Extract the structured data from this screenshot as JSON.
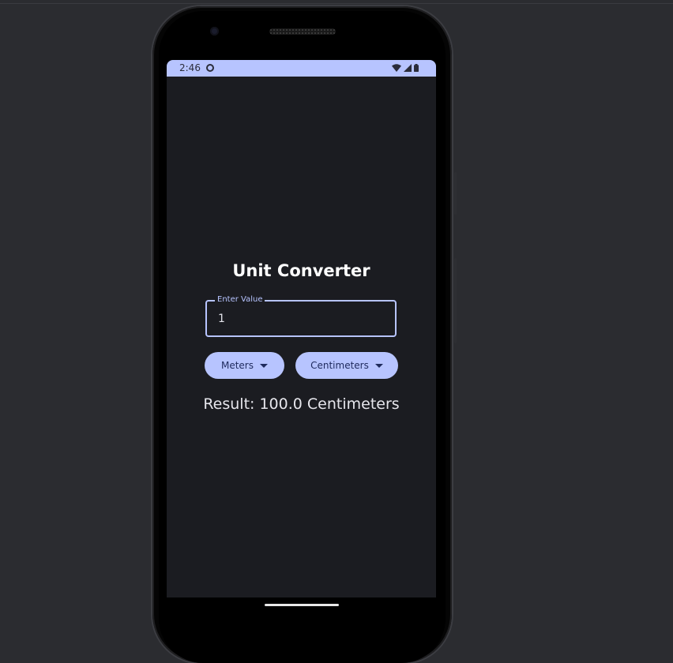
{
  "status_bar": {
    "time": "2:46"
  },
  "app": {
    "title": "Unit Converter",
    "input": {
      "label": "Enter Value",
      "value": "1"
    },
    "from_unit": {
      "selected": "Meters"
    },
    "to_unit": {
      "selected": "Centimeters"
    },
    "result_text": "Result: 100.0 Centimeters"
  },
  "colors": {
    "accent": "#b7c4ff",
    "background": "#1b1c21",
    "text": "#ffffff",
    "button_text": "#1f2a5c"
  },
  "icons": [
    "notification-icon",
    "wifi-icon",
    "signal-icon",
    "battery-icon",
    "chevron-down-icon"
  ]
}
